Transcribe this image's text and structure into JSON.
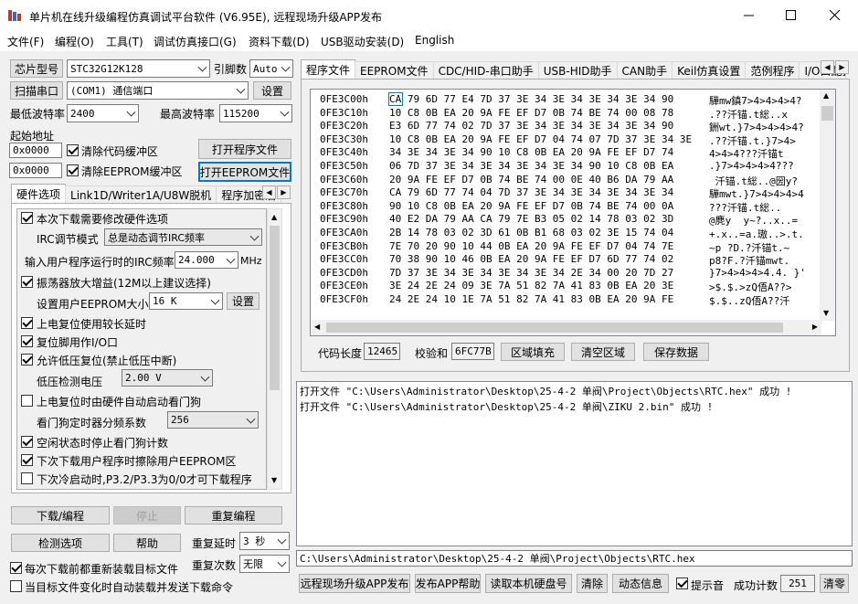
{
  "window": {
    "title": "单片机在线升级编程仿真调试平台软件 (V6.95E), 远程现场升级APP发布",
    "bg_title": "",
    "minimize": "—",
    "maximize": "☐",
    "close": "✕"
  },
  "menu": [
    "文件(F)",
    "编程(O)",
    "工具(T)",
    "调试仿真接口(G)",
    "资料下载(D)",
    "USB驱动安装(D)",
    "English"
  ],
  "chip": {
    "label": "芯片型号",
    "value": "STC32G12K128",
    "pins_label": "引脚数",
    "pins_value": "Auto"
  },
  "port": {
    "scan_label": "扫描串口",
    "value": "(COM1) 通信端口",
    "settings": "设置"
  },
  "baud": {
    "min_label": "最低波特率",
    "min_value": "2400",
    "max_label": "最高波特率",
    "max_value": "115200"
  },
  "start_addr": {
    "label": "起始地址",
    "addr1": "0x0000",
    "clear_code": "清除代码缓冲区",
    "open_prog": "打开程序文件",
    "addr2": "0x0000",
    "clear_eeprom": "清除EEPROM缓冲区",
    "open_eeprom": "打开EEPROM文件"
  },
  "left_tabs": [
    "硬件选项",
    "Link1D/Writer1A/U8W脱机",
    "程序加密后"
  ],
  "hw_options": {
    "opt1": "本次下载需要修改硬件选项",
    "irc_mode_label": "IRC调节模式",
    "irc_mode_value": "总是动态调节IRC频率",
    "irc_freq_label": "输入用户程序运行时的IRC频率",
    "irc_freq_value": "24.000",
    "irc_unit": "MHz",
    "opt2": "振荡器放大增益(12M以上建议选择)",
    "eeprom_label": "设置用户EEPROM大小",
    "eeprom_value": "16 K",
    "eeprom_btn": "设置",
    "opt3": "上电复位使用较长延时",
    "opt4": "复位脚用作I/O口",
    "opt5": "允许低压复位(禁止低压中断)",
    "lvd_label": "低压检测电压",
    "lvd_value": "2.00 V",
    "opt6": "上电复位时由硬件自动启动看门狗",
    "wdt_label": "看门狗定时器分频系数",
    "wdt_value": "256",
    "opt7": "空闲状态时停止看门狗计数",
    "opt8": "下次下载用户程序时擦除用户EEPROM区",
    "opt9": "下次冷启动时,P3.2/P3.3为0/0才可下载程序"
  },
  "actions": {
    "download": "下载/编程",
    "stop": "停止",
    "reprogram": "重复编程",
    "check": "检测选项",
    "help": "帮助",
    "delay_label": "重复延时",
    "delay_value": "3 秒",
    "count_label": "重复次数",
    "count_value": "无限",
    "reload": "每次下载前都重新装载目标文件",
    "autosend": "当目标文件变化时自动装载并发送下载命令"
  },
  "right_tabs": [
    "程序文件",
    "EEPROM文件",
    "CDC/HID-串口助手",
    "USB-HID助手",
    "CAN助手",
    "Keil仿真设置",
    "范例程序",
    "I/O口配置"
  ],
  "hex": {
    "rows": [
      {
        "addr": "0FE3C00h",
        "bytes": "CA 79 6D 77 E4 7D 37 3E 34 3E 34 3E 34 3E 34 90",
        "ascii": "驊mw鎮7>4>4>4>4?"
      },
      {
        "addr": "0FE3C10h",
        "bytes": "10 C8 0B EA 20 9A FE EF D7 0B 74 BE 74 00 08 78",
        "ascii": ".??汘锚.t総..x"
      },
      {
        "addr": "0FE3C20h",
        "bytes": "E3 6D 77 74 02 7D 37 3E 34 3E 34 3E 34 3E 34 90",
        "ascii": "銂wt.}7>4>4>4>4?"
      },
      {
        "addr": "0FE3C30h",
        "bytes": "10 C8 0B EA 20 9A FE EF D7 04 74 07 7D 37 3E 34 3E",
        "ascii": ".??汘锚.t.}7>4>"
      },
      {
        "addr": "0FE3C40h",
        "bytes": "34 3E 34 3E 34 90 10 C8 0B EA 20 9A FE EF D7 74",
        "ascii": "4>4>4???汘锚t"
      },
      {
        "addr": "0FE3C50h",
        "bytes": "06 7D 37 3E 34 3E 34 3E 34 3E 34 90 10 C8 0B EA",
        "ascii": ".}7>4>4>4>4???"
      },
      {
        "addr": "0FE3C60h",
        "bytes": "20 9A FE EF D7 0B 74 BE 74 00 0E 40 B6 DA 79 AA",
        "ascii": " 汘锚.t総..@圀y?"
      },
      {
        "addr": "0FE3C70h",
        "bytes": "CA 79 6D 77 74 04 7D 37 3E 34 3E 34 3E 34 3E 34",
        "ascii": "驊mwt.}7>4>4>4>4"
      },
      {
        "addr": "0FE3C80h",
        "bytes": "90 10 C8 0B EA 20 9A FE EF D7 0B 74 BE 74 00 0A",
        "ascii": "???汘锚.t総.."
      },
      {
        "addr": "0FE3C90h",
        "bytes": "40 E2 DA 79 AA CA 79 7E B3 05 02 14 78 03 02 3D",
        "ascii": "@麂y  y~?..x..="
      },
      {
        "addr": "0FE3CA0h",
        "bytes": "2B 14 78 03 02 3D 61 0B B1 68 03 02 3E 15 74 04",
        "ascii": "+.x..=a.璈..>.t."
      },
      {
        "addr": "0FE3CB0h",
        "bytes": "7E 70 20 90 10 44 0B EA 20 9A FE EF D7 04 74 7E",
        "ascii": "~p ?D.?汘锚t.~"
      },
      {
        "addr": "0FE3CC0h",
        "bytes": "70 38 90 10 46 0B EA 20 9A FE EF D7 6D 77 74 02",
        "ascii": "p8?F.?汘锚mwt."
      },
      {
        "addr": "0FE3CD0h",
        "bytes": "7D 37 3E 34 3E 34 3E 34 3E 34 2E 34 00 20 7D 27",
        "ascii": "}7>4>4>4>4.4. }'"
      },
      {
        "addr": "0FE3CE0h",
        "bytes": "3E 24 2E 24 09 3E 7A 51 82 7A 41 83 0B EA 20 3E",
        "ascii": ">$.$.>zQ俉A??>"
      },
      {
        "addr": "0FE3CF0h",
        "bytes": "24 2E 24 10 1E 7A 51 82 7A 41 83 0B EA 20 9A FE",
        "ascii": "$.$..zQ俉A??汘"
      }
    ]
  },
  "hex_footer": {
    "len_label": "代码长度",
    "len_value": "12465",
    "checksum_label": "校验和",
    "checksum_value": "6FC77B",
    "fill": "区域填充",
    "clear": "清空区域",
    "save": "保存数据"
  },
  "log": [
    "打开文件 \"C:\\Users\\Administrator\\Desktop\\25-4-2 单阀\\Project\\Objects\\RTC.hex\" 成功 !",
    "打开文件 \"C:\\Users\\Administrator\\Desktop\\25-4-2 单阀\\ZIKU 2.bin\" 成功 !"
  ],
  "path": "C:\\Users\\Administrator\\Desktop\\25-4-2 单阀\\Project\\Objects\\RTC.hex",
  "bottom": {
    "remote": "远程现场升级APP发布",
    "publish_help": "发布APP帮助",
    "read_disk": "读取本机硬盘号",
    "clear": "清除",
    "anim": "动态信息",
    "sound": "提示音",
    "success_label": "成功计数",
    "success_value": "251",
    "reset": "清零"
  },
  "colors": {
    "accent": "#0078d7",
    "title_bg": "#ffffff"
  }
}
